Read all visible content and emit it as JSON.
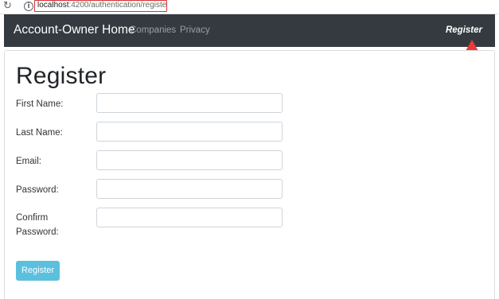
{
  "browser": {
    "reload_icon": "reload-icon",
    "info_icon": "info-icon",
    "url_host": "localhost",
    "url_path": ":4200/authentication/register"
  },
  "navbar": {
    "brand": "Account-Owner Home",
    "links": [
      "Companies",
      "Privacy"
    ],
    "register": "Register",
    "background": "#343a40"
  },
  "annotation": {
    "arrow_color": "#e83a3a",
    "url_highlight_color": "#d93030"
  },
  "form": {
    "title": "Register",
    "fields": [
      {
        "label": "First Name:",
        "value": ""
      },
      {
        "label": "Last Name:",
        "value": ""
      },
      {
        "label": "Email:",
        "value": ""
      },
      {
        "label": "Password:",
        "value": ""
      },
      {
        "label": "Confirm Password:",
        "value": ""
      }
    ],
    "submit_label": "Register",
    "submit_color": "#5bc0de"
  }
}
